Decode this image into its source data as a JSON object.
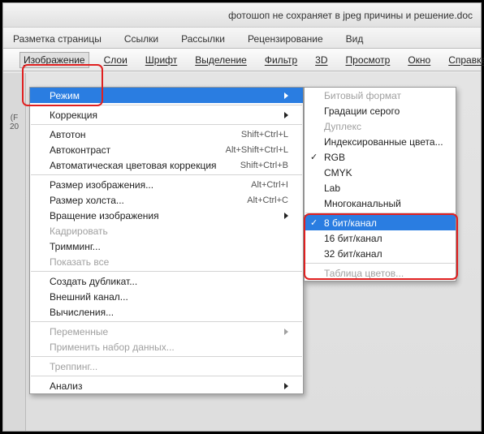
{
  "title": "фотошоп не сохраняет в jpeg причины и решение.doc",
  "tabs": {
    "t0": "Разметка страницы",
    "t1": "Ссылки",
    "t2": "Рассылки",
    "t3": "Рецензирование",
    "t4": "Вид"
  },
  "menubar": {
    "m0": "Изображение",
    "m1": "Слои",
    "m2": "Шрифт",
    "m3": "Выделение",
    "m4": "Фильтр",
    "m5": "3D",
    "m6": "Просмотр",
    "m7": "Окно",
    "m8": "Справка"
  },
  "left_strip": {
    "a": "(F",
    "b": "20"
  },
  "menu1": {
    "mode": "Режим",
    "correction": "Коррекция",
    "autotone": {
      "l": "Автотон",
      "s": "Shift+Ctrl+L"
    },
    "autocontrast": {
      "l": "Автоконтраст",
      "s": "Alt+Shift+Ctrl+L"
    },
    "autocolor": {
      "l": "Автоматическая цветовая коррекция",
      "s": "Shift+Ctrl+B"
    },
    "imgsize": {
      "l": "Размер изображения...",
      "s": "Alt+Ctrl+I"
    },
    "canvassize": {
      "l": "Размер холста...",
      "s": "Alt+Ctrl+C"
    },
    "rotate": "Вращение изображения",
    "crop": "Кадрировать",
    "trim": "Тримминг...",
    "showall": "Показать все",
    "duplicate": "Создать дубликат...",
    "applyimg": "Внешний канал...",
    "calc": "Вычисления...",
    "variables": "Переменные",
    "applydata": "Применить набор данных...",
    "trap": "Треппинг...",
    "analysis": "Анализ"
  },
  "menu2": {
    "bitmap": "Битовый формат",
    "grayscale": "Градации серого",
    "duotone": "Дуплекс",
    "indexed": "Индексированные цвета...",
    "rgb": "RGB",
    "cmyk": "CMYK",
    "lab": "Lab",
    "multi": "Многоканальный",
    "b8": "8 бит/канал",
    "b16": "16 бит/канал",
    "b32": "32 бит/канал",
    "colortable": "Таблица цветов..."
  }
}
